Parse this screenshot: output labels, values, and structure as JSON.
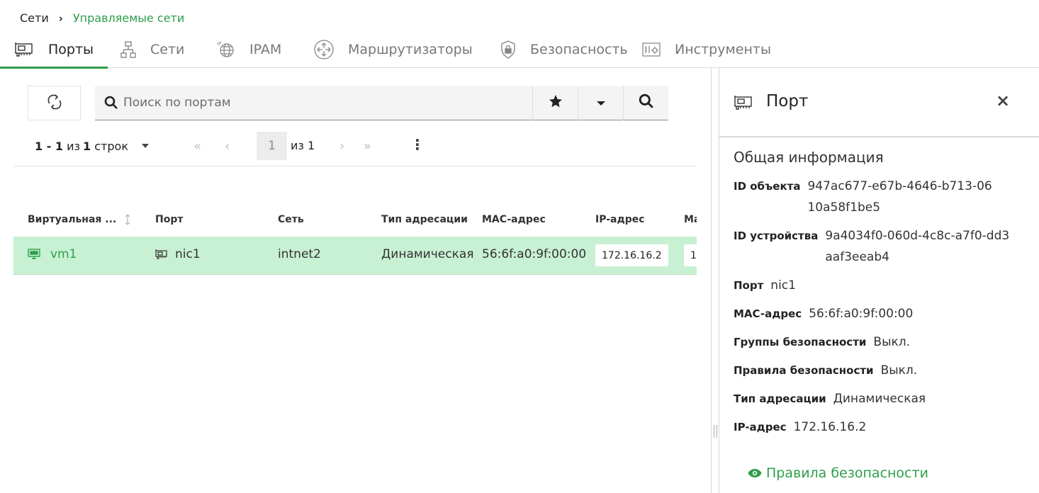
{
  "breadcrumb": {
    "root": "Сети",
    "current": "Управляемые сети"
  },
  "tabs": [
    {
      "label": "Порты",
      "icon": "network-card-icon",
      "active": true
    },
    {
      "label": "Сети",
      "icon": "hierarchy-icon"
    },
    {
      "label": "IPAM",
      "icon": "ip-globe-icon"
    },
    {
      "label": "Маршрутизаторы",
      "icon": "router-icon"
    },
    {
      "label": "Безопасность",
      "icon": "shield-lock-icon"
    },
    {
      "label": "Инструменты",
      "icon": "tools-icon"
    }
  ],
  "search": {
    "placeholder": "Поиск по портам",
    "value": ""
  },
  "pager": {
    "range": "1 - 1",
    "of_word": "из",
    "total": "1",
    "rows_word": "строк",
    "page": "1",
    "page_of": "из 1"
  },
  "table": {
    "columns": [
      "Виртуальная ...",
      "Порт",
      "Сеть",
      "Тип адресации",
      "MAC-адрес",
      "IP-адрес",
      "Ма"
    ],
    "rows": [
      {
        "vm": "vm1",
        "port": "nic1",
        "network": "intnet2",
        "addressing": "Динамическая",
        "mac": "56:6f:a0:9f:00:00",
        "ip": "172.16.16.2",
        "more": "1"
      }
    ]
  },
  "panel": {
    "title": "Порт",
    "close": "×",
    "section": "Общая информация",
    "fields": {
      "object_id_label": "ID объекта",
      "object_id": "947ac677-e67b-4646-b713-0610a58f1be5",
      "device_id_label": "ID устройства",
      "device_id": "9a4034f0-060d-4c8c-a7f0-dd3aaf3eeab4",
      "port_label": "Порт",
      "port": "nic1",
      "mac_label": "MAC-адрес",
      "mac": "56:6f:a0:9f:00:00",
      "sec_groups_label": "Группы безопасности",
      "sec_groups": "Выкл.",
      "sec_rules_label": "Правила безопасности",
      "sec_rules": "Выкл.",
      "addr_type_label": "Тип адресации",
      "addr_type": "Динамическая",
      "ip_label": "IP-адрес",
      "ip": "172.16.16.2"
    },
    "link": "Правила безопасности"
  },
  "colors": {
    "accent": "#2e9e4a",
    "row_selected": "#c8f1d3"
  }
}
